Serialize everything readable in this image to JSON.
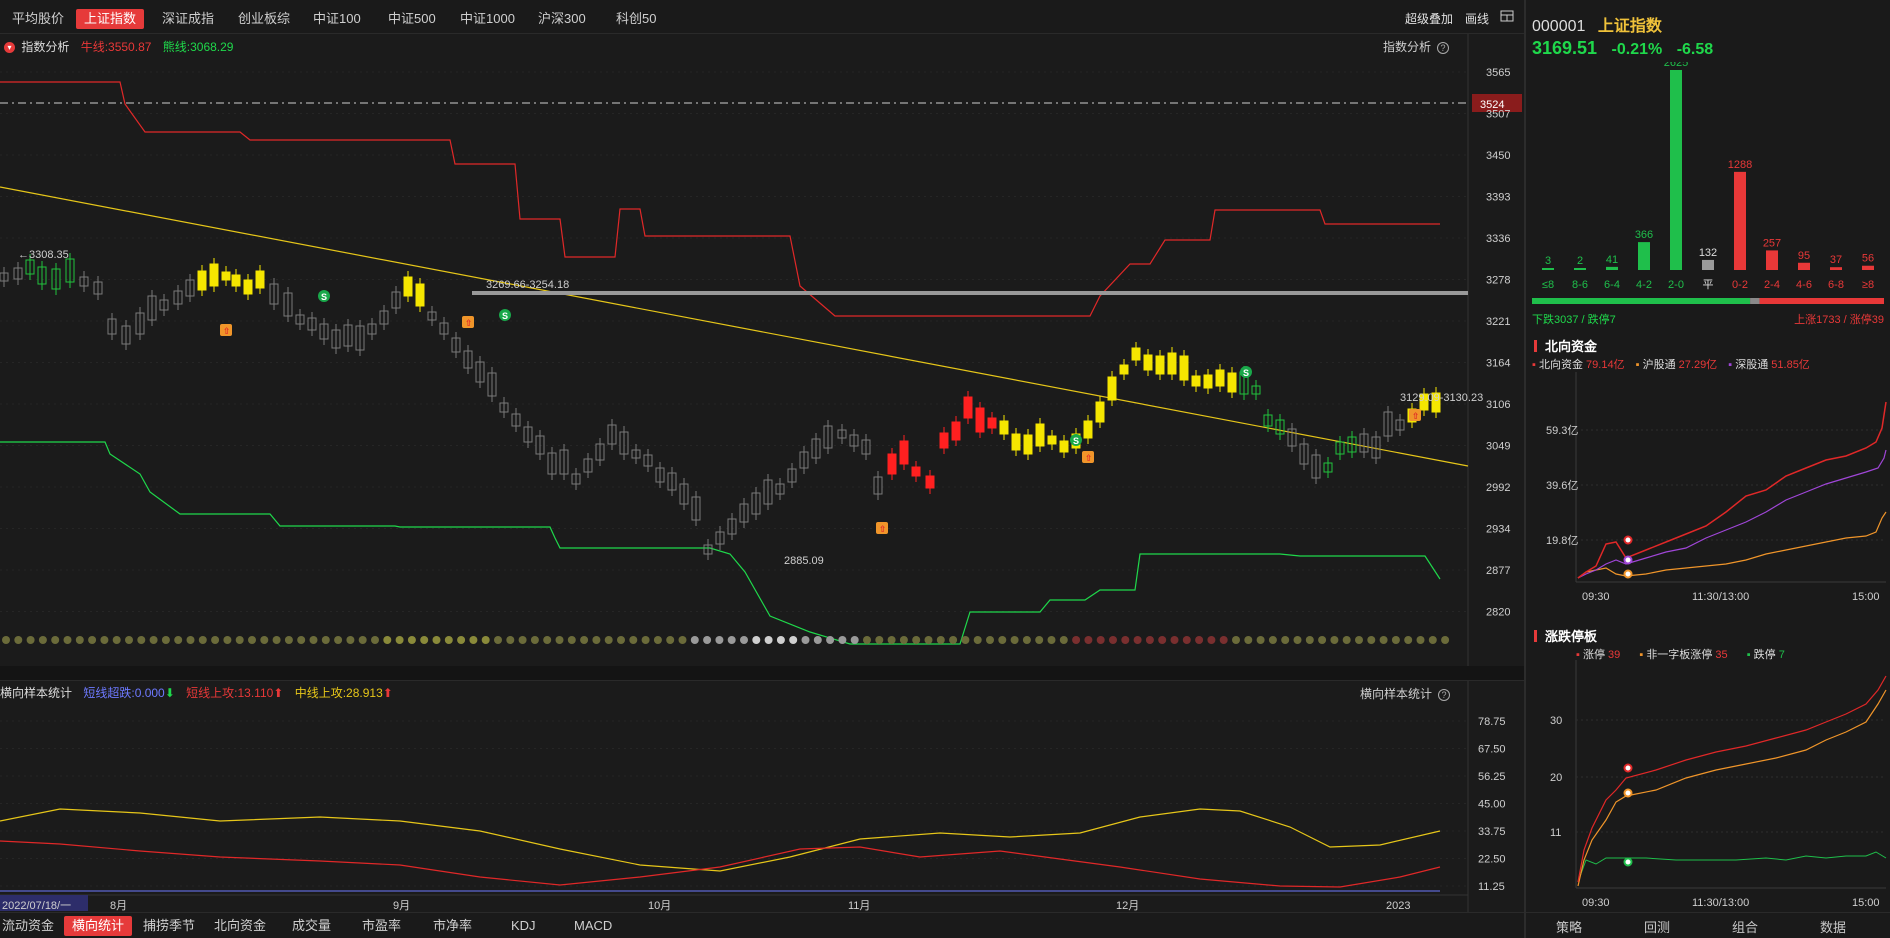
{
  "top_tabs": [
    "平均股价",
    "上证指数",
    "深证成指",
    "创业板综",
    "中证100",
    "中证500",
    "中证1000",
    "沪深300",
    "科创50"
  ],
  "active_tab": "上证指数",
  "toolbar": {
    "overlay": "超级叠加",
    "draw": "画线",
    "layout_icon": "grid-icon"
  },
  "main_chart": {
    "indicator_name": "指数分析",
    "bull_line": "牛线:3550.87",
    "bear_line": "熊线:3068.29",
    "y_ticks": [
      "3565",
      "3507",
      "3450",
      "3393",
      "3336",
      "3278",
      "3221",
      "3164",
      "3106",
      "3049",
      "2992",
      "2934",
      "2877",
      "2820"
    ],
    "price_tag": "3524",
    "annotations": {
      "high_left": "←3308.35",
      "mid_range": "3269.66-3254.18",
      "low": "2885.09",
      "right_range": "3129.09-3130.23"
    }
  },
  "sub_chart": {
    "name": "横向样本统计",
    "short_over": "短线超跌:0.000",
    "short_up": "短线上攻:13.110",
    "mid_up": "中线上攻:28.913",
    "y_ticks": [
      "78.75",
      "67.50",
      "56.25",
      "45.00",
      "33.75",
      "22.50",
      "11.25"
    ],
    "x_labels": [
      "2022/07/18/一",
      "8月",
      "9月",
      "10月",
      "11月",
      "12月",
      "2023"
    ]
  },
  "bottom_tabs": [
    "流动资金",
    "横向统计",
    "捕捞季节",
    "北向资金",
    "成交量",
    "市盈率",
    "市净率",
    "KDJ",
    "MACD"
  ],
  "bottom_active": "横向统计",
  "quote": {
    "code": "000001",
    "name": "上证指数",
    "price": "3169.51",
    "pct": "-0.21%",
    "change": "-6.58"
  },
  "distribution": {
    "bins": [
      "≤8",
      "8-6",
      "6-4",
      "4-2",
      "2-0",
      "平",
      "0-2",
      "2-4",
      "4-6",
      "6-8",
      "≥8"
    ],
    "counts": [
      3,
      2,
      41,
      366,
      2625,
      132,
      1288,
      257,
      95,
      37,
      56
    ],
    "colors": [
      "#1fbf4b",
      "#1fbf4b",
      "#1fbf4b",
      "#1fbf4b",
      "#1fbf4b",
      "#9a9a9a",
      "#e83838",
      "#e83838",
      "#e83838",
      "#e83838",
      "#e83838"
    ],
    "down_text": "下跌3037 / 跌停7",
    "up_text": "上涨1733 / 涨停39"
  },
  "northbound": {
    "title": "北向资金",
    "legend": [
      {
        "label": "北向资金",
        "value": "79.14亿",
        "color": "#e83838"
      },
      {
        "label": "沪股通",
        "value": "27.29亿",
        "color": "#f0952a"
      },
      {
        "label": "深股通",
        "value": "51.85亿",
        "color": "#a046d8"
      }
    ],
    "y_ticks": [
      "59.3亿",
      "39.6亿",
      "19.8亿"
    ],
    "x_labels": [
      "09:30",
      "11:30/13:00",
      "15:00"
    ]
  },
  "limit_board": {
    "title": "涨跌停板",
    "legend": [
      {
        "label": "涨停",
        "value": "39",
        "color": "#e83838"
      },
      {
        "label": "非一字板涨停",
        "value": "35",
        "color": "#f0952a"
      },
      {
        "label": "跌停",
        "value": "7",
        "color": "#1fbf4b"
      }
    ],
    "y_ticks": [
      "30",
      "20",
      "11"
    ],
    "x_labels": [
      "09:30",
      "11:30/13:00",
      "15:00"
    ]
  },
  "side_bottom_tabs": [
    "策略",
    "回测",
    "组合",
    "数据"
  ]
}
